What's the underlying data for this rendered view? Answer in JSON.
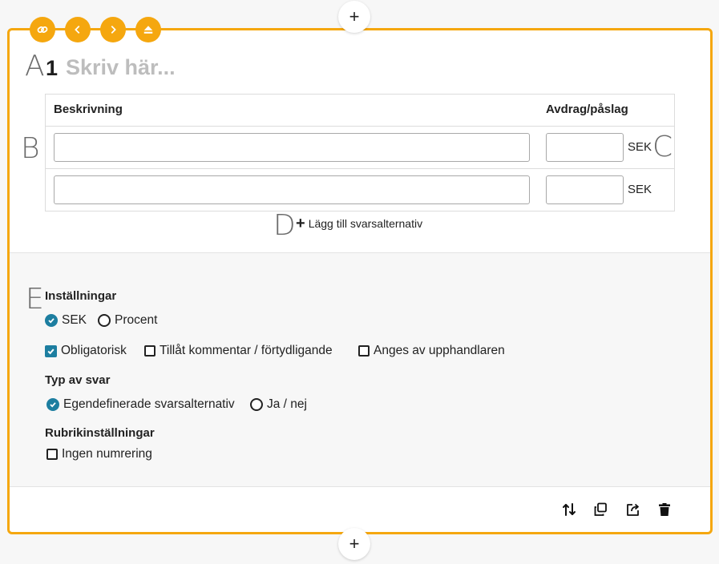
{
  "question": {
    "number": "1",
    "title_placeholder": "Skriv här..."
  },
  "markers": {
    "a": "A",
    "b": "B",
    "c": "C",
    "d": "D",
    "e": "E"
  },
  "table": {
    "col_description": "Beskrivning",
    "col_amount": "Avdrag/påslag",
    "rows": [
      {
        "description": "",
        "amount": "",
        "unit": "SEK"
      },
      {
        "description": "",
        "amount": "",
        "unit": "SEK"
      }
    ],
    "add_label": "Lägg till svarsalternativ"
  },
  "settings": {
    "heading": "Inställningar",
    "unit_options": [
      {
        "label": "SEK",
        "selected": true
      },
      {
        "label": "Procent",
        "selected": false
      }
    ],
    "flags": [
      {
        "label": "Obligatorisk",
        "checked": true
      },
      {
        "label": "Tillåt kommentar / förtydligande",
        "checked": false
      },
      {
        "label": "Anges av upphandlaren",
        "checked": false
      }
    ],
    "answer_type_heading": "Typ av svar",
    "answer_types": [
      {
        "label": "Egendefinerade svarsalternativ",
        "selected": true
      },
      {
        "label": "Ja / nej",
        "selected": false
      }
    ],
    "heading_settings_heading": "Rubrikinställningar",
    "heading_options": [
      {
        "label": "Ingen numrering",
        "checked": false
      }
    ]
  },
  "colors": {
    "accent": "#f5a70f",
    "selected": "#1d7ea0"
  },
  "icons": {
    "top_tools": [
      "link-icon",
      "chevron-left-icon",
      "chevron-right-icon",
      "eject-icon"
    ],
    "footer": [
      "sort-arrows-icon",
      "copy-icon",
      "share-icon",
      "trash-icon"
    ],
    "add": "plus-icon"
  }
}
